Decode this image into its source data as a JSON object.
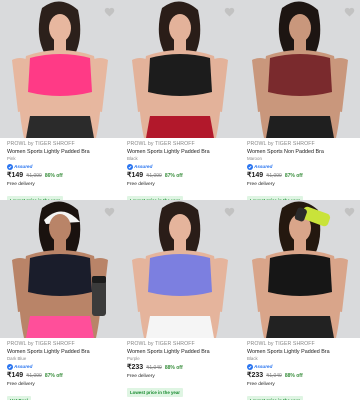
{
  "products": [
    {
      "brand": "PROWL by TIGER SHROFF",
      "title": "Women Sports Lightly Padded Bra",
      "color": "Pink",
      "assured": "Assured",
      "price": "₹149",
      "mrp": "₹1,099",
      "discount": "86% off",
      "delivery": "Free delivery",
      "badge": "Lowest price in the year",
      "colors": {
        "bg": "#d9dadc",
        "bra": "#ff3a86",
        "bottom": "#2b2b2b",
        "skin": "#e7b79f",
        "hair": "#2c201b"
      }
    },
    {
      "brand": "PROWL by TIGER SHROFF",
      "title": "Women Sports Lightly Padded Bra",
      "color": "Black",
      "assured": "Assured",
      "price": "₹149",
      "mrp": "₹1,099",
      "discount": "87% off",
      "delivery": "Free delivery",
      "badge": "Lowest price in the year",
      "colors": {
        "bg": "#d9dadc",
        "bra": "#1c1c1c",
        "bottom": "#b2182b",
        "skin": "#e3b29a",
        "hair": "#2a1d18"
      }
    },
    {
      "brand": "PROWL by TIGER SHROFF",
      "title": "Women Sports Non Padded Bra",
      "color": "Maroon",
      "assured": "Assured",
      "price": "₹149",
      "mrp": "₹1,099",
      "discount": "87% off",
      "delivery": "Free delivery",
      "badge": "Lowest price in the year",
      "colors": {
        "bg": "#d9dadc",
        "bra": "#7a2a2d",
        "bottom": "#1f1f1f",
        "skin": "#c9977c",
        "hair": "#1d1512"
      }
    },
    {
      "brand": "PROWL by TIGER SHROFF",
      "title": "Women Sports Lightly Padded Bra",
      "color": "Dark Blue",
      "assured": "Assured",
      "price": "₹149",
      "mrp": "₹1,099",
      "discount": "87% off",
      "delivery": "Free delivery",
      "badge": "Hot Deal",
      "colors": {
        "bg": "#d9dadc",
        "bra": "#1a1d2b",
        "bottom": "#ff4f9a",
        "skin": "#b98468",
        "hair": "#1a120f"
      }
    },
    {
      "brand": "PROWL by TIGER SHROFF",
      "title": "Women Sports Lightly Padded Bra",
      "color": "Purple",
      "assured": "",
      "price": "₹233",
      "mrp": "₹1,049",
      "discount": "88% off",
      "delivery": "Free delivery",
      "badge": "Lowest price in the year",
      "colors": {
        "bg": "#d9dadc",
        "bra": "#7c7fe0",
        "bottom": "#f5f5f5",
        "skin": "#e5b49c",
        "hair": "#2a1d18"
      }
    },
    {
      "brand": "PROWL by TIGER SHROFF",
      "title": "Women Sports Lightly Padded Bra",
      "color": "Black",
      "assured": "Assured",
      "price": "₹233",
      "mrp": "₹1,049",
      "discount": "88% off",
      "delivery": "Free delivery",
      "badge": "Lowest price in the year",
      "colors": {
        "bg": "#d9dadc",
        "bra": "#161616",
        "bottom": "#222222",
        "skin": "#d9a58a",
        "hair": "#24180f"
      }
    }
  ]
}
